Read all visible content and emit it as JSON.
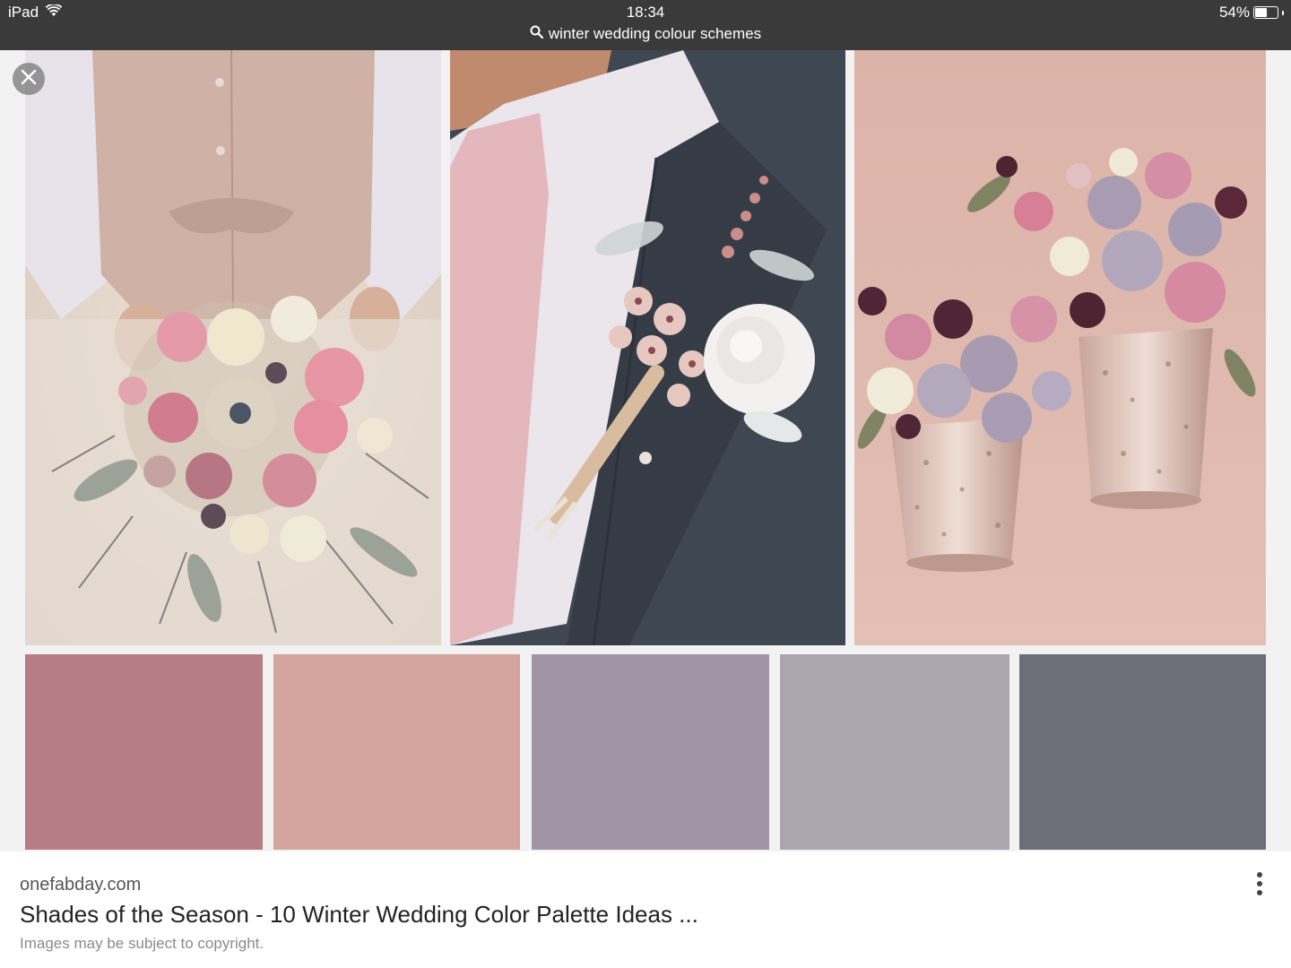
{
  "status_bar": {
    "device": "iPad",
    "time": "18:34",
    "battery": "54%",
    "battery_level": 0.54,
    "search_query": "winter wedding colour schemes"
  },
  "icons": {
    "wifi": "wifi-icon",
    "search": "search-icon",
    "battery": "battery-icon",
    "close": "close-icon",
    "more": "more-vertical-icon"
  },
  "palette": [
    {
      "name": "dusty-rose",
      "color": "#b67d87"
    },
    {
      "name": "blush",
      "color": "#d4a59d"
    },
    {
      "name": "mauve",
      "color": "#a094a5"
    },
    {
      "name": "lavender-grey",
      "color": "#aaa5ae"
    },
    {
      "name": "slate",
      "color": "#6c6f77"
    }
  ],
  "result": {
    "site": "onefabday.com",
    "title": "Shades of the Season - 10 Winter Wedding Color Palette Ideas ...",
    "copyright": "Images may be subject to copyright."
  }
}
